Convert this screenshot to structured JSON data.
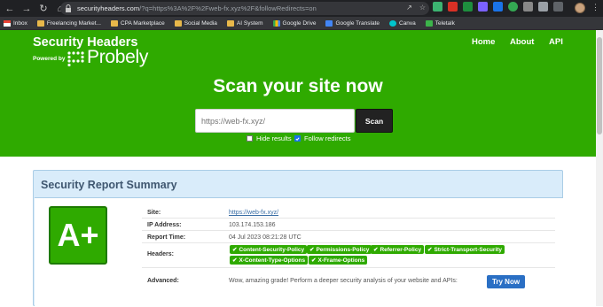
{
  "browser": {
    "url_host": "securityheaders.com",
    "url_path": "/?q=https%3A%2F%2Fweb-fx.xyz%2F&followRedirects=on",
    "bookmarks": [
      {
        "label": "Inbox",
        "icon": "gmail-icon"
      },
      {
        "label": "Freelancing Market...",
        "icon": "folder-icon"
      },
      {
        "label": "CPA Marketplace",
        "icon": "folder-icon"
      },
      {
        "label": "Social Media",
        "icon": "folder-icon"
      },
      {
        "label": "AI System",
        "icon": "folder-icon"
      },
      {
        "label": "Google Drive",
        "icon": "google-drive-icon"
      },
      {
        "label": "Google Translate",
        "icon": "google-translate-icon"
      },
      {
        "label": "Canva",
        "icon": "canva-icon"
      },
      {
        "label": "Teletalk",
        "icon": "teletalk-icon"
      }
    ]
  },
  "header": {
    "brand": "Security Headers",
    "powered_by": "Powered by",
    "probely": "Probely",
    "nav": [
      "Home",
      "About",
      "API"
    ]
  },
  "scan": {
    "title": "Scan your site now",
    "placeholder": "https://web-fx.xyz/",
    "button": "Scan",
    "hide_results": "Hide results",
    "follow_redirects": "Follow redirects",
    "hide_results_checked": false,
    "follow_redirects_checked": true
  },
  "report": {
    "title": "Security Report Summary",
    "grade": "A+",
    "rows": {
      "site_label": "Site:",
      "site_value": "https://web-fx.xyz/",
      "ip_label": "IP Address:",
      "ip_value": "103.174.153.186",
      "time_label": "Report Time:",
      "time_value": "04 Jul 2023 08:21:28 UTC",
      "headers_label": "Headers:",
      "advanced_label": "Advanced:",
      "advanced_value": "Wow, amazing grade! Perform a deeper security analysis of your website and APIs:",
      "try_now": "Try Now"
    },
    "headers": [
      "Content-Security-Policy",
      "Permissions-Policy",
      "Referrer-Policy",
      "Strict-Transport-Security",
      "X-Content-Type-Options",
      "X-Frame-Options"
    ]
  },
  "colors": {
    "brand_green": "#2faa00",
    "panel_blue": "#d9ecfa",
    "button_blue": "#2a6fc4"
  }
}
